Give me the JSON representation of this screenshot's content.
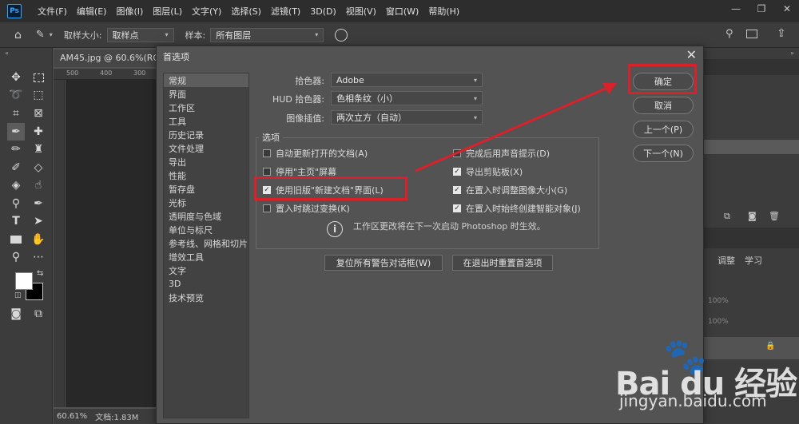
{
  "app": {
    "logo": "Ps",
    "menu": [
      "文件(F)",
      "编辑(E)",
      "图像(I)",
      "图层(L)",
      "文字(Y)",
      "选择(S)",
      "滤镜(T)",
      "3D(D)",
      "视图(V)",
      "窗口(W)",
      "帮助(H)"
    ]
  },
  "optbar": {
    "sample_size_label": "取样大小:",
    "sample_size_value": "取样点",
    "sample_label": "样本:",
    "sample_value": "所有图层"
  },
  "document": {
    "tab_title": "AM45.jpg @ 60.6%(RGB/8",
    "ruler_ticks": [
      "500",
      "400",
      "300"
    ],
    "zoom": "60.61%",
    "doc_info": "文档:1.83M"
  },
  "right_panel": {
    "tab_adjust": "调整",
    "tab_learn": "学习",
    "opacity1": "100%",
    "opacity2": "100%"
  },
  "dialog": {
    "title": "首选项",
    "categories": [
      "常规",
      "界面",
      "工作区",
      "工具",
      "历史记录",
      "文件处理",
      "导出",
      "性能",
      "暂存盘",
      "光标",
      "透明度与色域",
      "单位与标尺",
      "参考线、网格和切片",
      "增效工具",
      "文字",
      "3D",
      "技术预览"
    ],
    "selected_category": "常规",
    "color_picker_label": "拾色器:",
    "color_picker_value": "Adobe",
    "hud_picker_label": "HUD 拾色器:",
    "hud_picker_value": "色相条纹（小）",
    "interpolation_label": "图像插值:",
    "interpolation_value": "两次立方（自动）",
    "options_title": "选项",
    "options": [
      {
        "label": "自动更新打开的文档(A)",
        "checked": false
      },
      {
        "label": "停用\"主页\"屏幕",
        "checked": false
      },
      {
        "label": "使用旧版\"新建文档\"界面(L)",
        "checked": true
      },
      {
        "label": "置入时跳过变换(K)",
        "checked": false
      },
      {
        "label": "完成后用声音提示(D)",
        "checked": false
      },
      {
        "label": "导出剪贴板(X)",
        "checked": true
      },
      {
        "label": "在置入时调整图像大小(G)",
        "checked": true
      },
      {
        "label": "在置入时始终创建智能对象(J)",
        "checked": true
      }
    ],
    "info_text": "工作区更改将在下一次启动 Photoshop 时生效。",
    "reset_warnings_button": "复位所有警告对话框(W)",
    "reset_on_quit_button": "在退出时重置首选项",
    "ok_button": "确定",
    "cancel_button": "取消",
    "prev_button": "上一个(P)",
    "next_button": "下一个(N)"
  },
  "watermark": {
    "logo_text": "Bai du 经验",
    "subtext": "jingyan.baidu.com"
  },
  "colors": {
    "highlight": "#d8212a",
    "accent": "#31a8ff"
  }
}
